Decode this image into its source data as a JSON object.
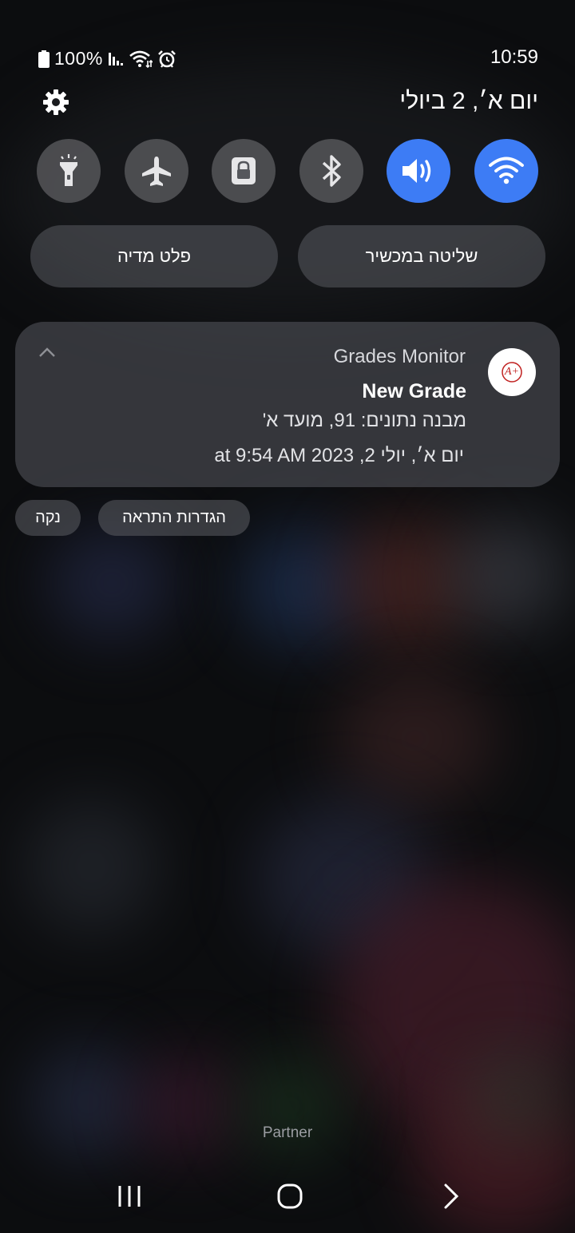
{
  "status_bar": {
    "battery_percent": "100%",
    "time": "10:59"
  },
  "header": {
    "date": "יום א׳, 2 ביולי"
  },
  "quick_settings": [
    {
      "name": "flashlight",
      "icon": "flashlight-icon",
      "active": false
    },
    {
      "name": "airplane-mode",
      "icon": "airplane-icon",
      "active": false
    },
    {
      "name": "lock",
      "icon": "lock-icon",
      "active": false
    },
    {
      "name": "bluetooth",
      "icon": "bluetooth-icon",
      "active": false
    },
    {
      "name": "sound",
      "icon": "volume-icon",
      "active": true
    },
    {
      "name": "wifi",
      "icon": "wifi-icon",
      "active": true
    }
  ],
  "colors": {
    "accent": "#3d7cf5"
  },
  "panel_buttons": {
    "media_output": "פלט מדיה",
    "device_control": "שליטה במכשיר"
  },
  "notification": {
    "app_name": "Grades Monitor",
    "title": "New Grade",
    "body": "מבנה נתונים: 91, מועד א'",
    "time": "יום א׳, יולי 2, 2023 at 9:54 AM",
    "icon_text": "A+"
  },
  "actions": {
    "notification_settings": "הגדרות התראה",
    "clear": "נקה"
  },
  "carrier": "Partner"
}
